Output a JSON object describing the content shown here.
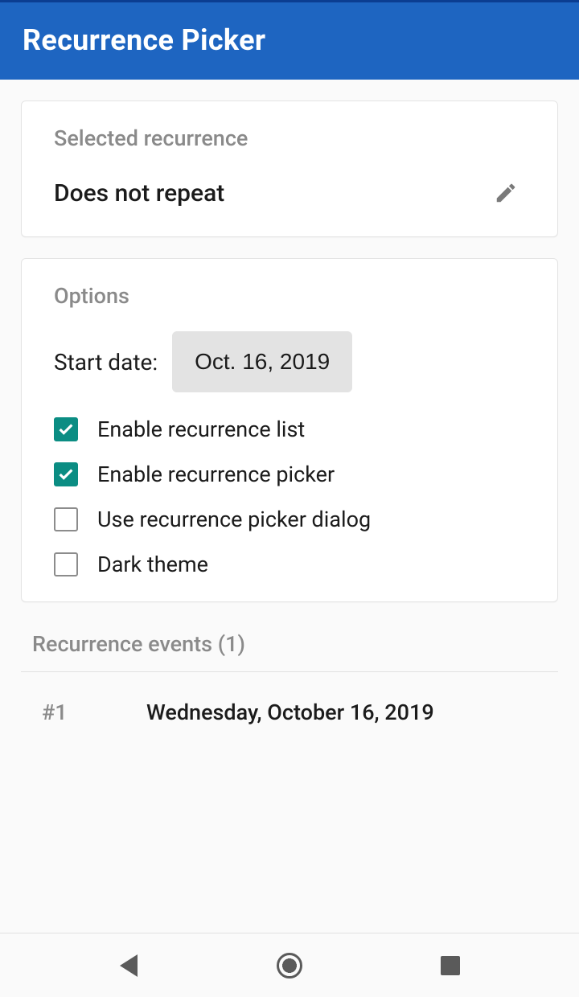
{
  "app": {
    "title": "Recurrence Picker"
  },
  "selected": {
    "section_title": "Selected recurrence",
    "value": "Does not repeat"
  },
  "options": {
    "section_title": "Options",
    "start_date_label": "Start date:",
    "start_date_value": "Oct. 16, 2019",
    "checkboxes": [
      {
        "label": "Enable recurrence list",
        "checked": true
      },
      {
        "label": "Enable recurrence picker",
        "checked": true
      },
      {
        "label": "Use recurrence picker dialog",
        "checked": false
      },
      {
        "label": "Dark theme",
        "checked": false
      }
    ]
  },
  "events": {
    "header": "Recurrence events (1)",
    "items": [
      {
        "index": "#1",
        "date": "Wednesday, October 16, 2019"
      }
    ]
  }
}
